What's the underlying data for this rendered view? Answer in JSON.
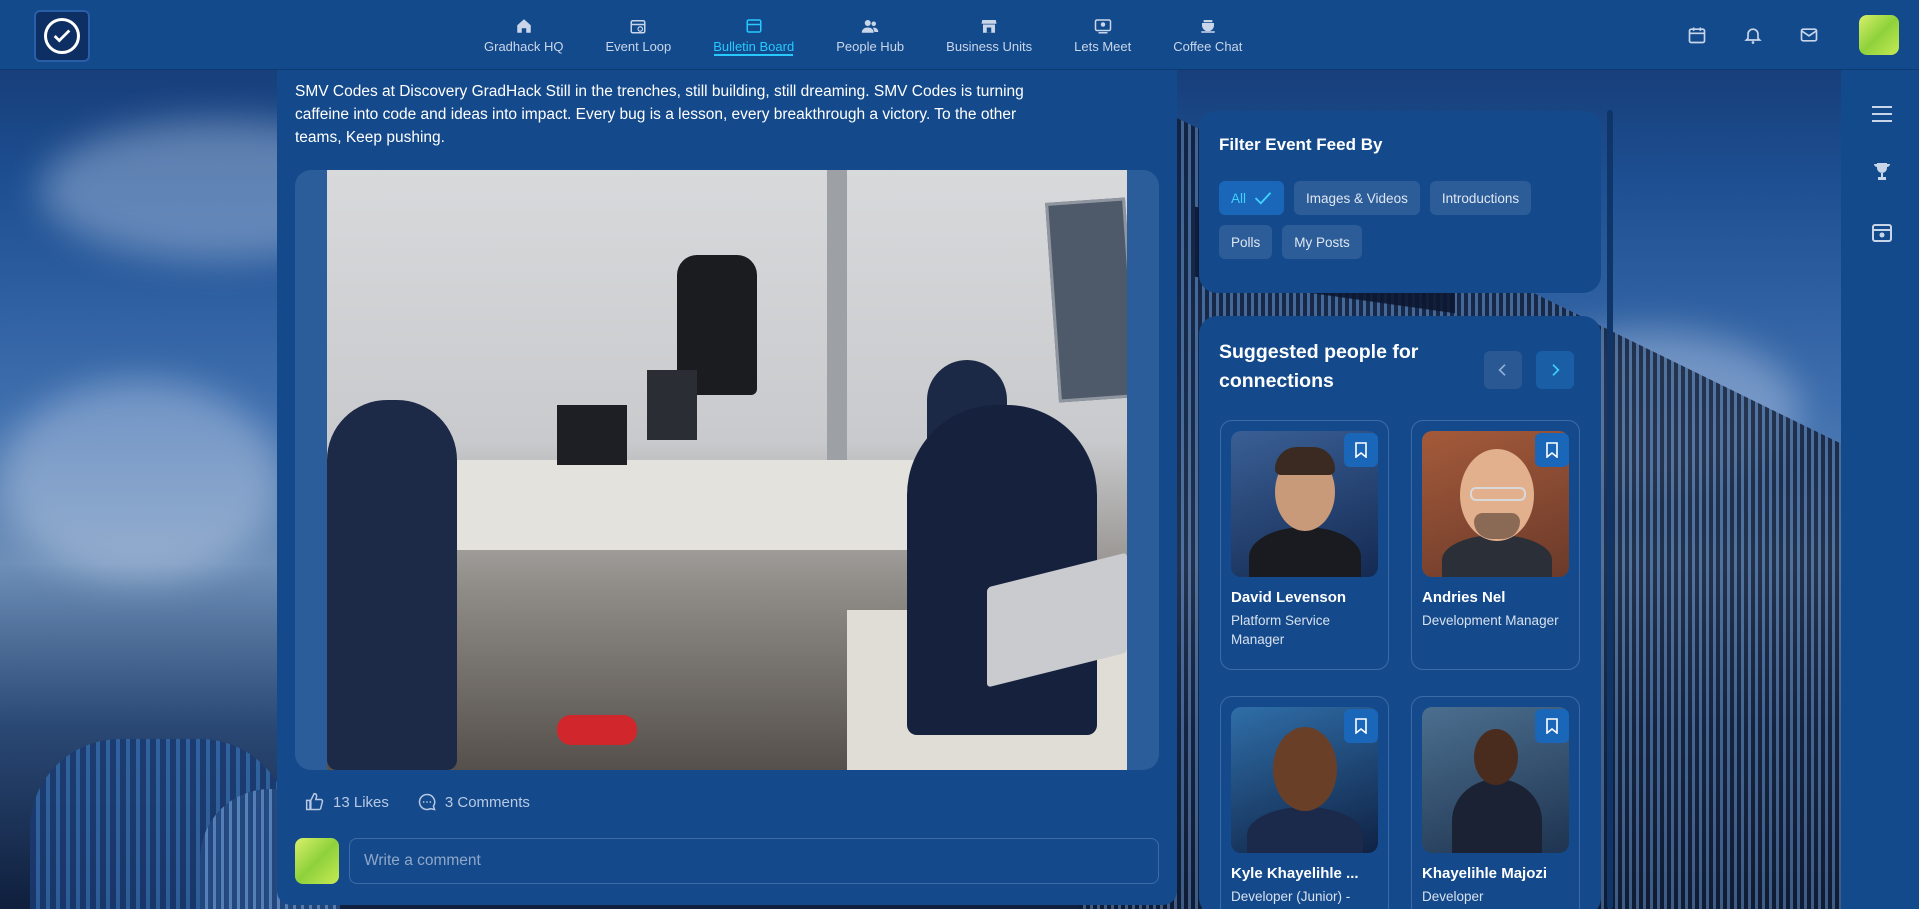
{
  "nav": {
    "items": [
      {
        "label": "Gradhack HQ",
        "icon": "home-icon"
      },
      {
        "label": "Event Loop",
        "icon": "calendar-clock-icon"
      },
      {
        "label": "Bulletin Board",
        "icon": "board-icon",
        "active": true
      },
      {
        "label": "People Hub",
        "icon": "people-icon"
      },
      {
        "label": "Business Units",
        "icon": "store-icon"
      },
      {
        "label": "Lets Meet",
        "icon": "video-meeting-icon"
      },
      {
        "label": "Coffee Chat",
        "icon": "coffee-icon"
      }
    ]
  },
  "post": {
    "text": "SMV Codes at Discovery GradHack  Still in the trenches, still building, still dreaming. SMV Codes is turning caffeine into code and ideas into impact. Every bug is a lesson, every breakthrough a victory. To the other teams, Keep pushing.",
    "likes_label": "13 Likes",
    "comments_label": "3 Comments",
    "comment_placeholder": "Write a comment"
  },
  "filter": {
    "title": "Filter Event Feed By",
    "chips": [
      "All",
      "Images & Videos",
      "Introductions",
      "Polls",
      "My Posts"
    ]
  },
  "suggested": {
    "title": "Suggested people for connections",
    "people": [
      {
        "name": "David Levenson",
        "role": "Platform Service Manager"
      },
      {
        "name": "Andries Nel",
        "role": "Development Manager"
      },
      {
        "name": "Kyle Khayelihle ...",
        "role": "Developer (Junior) -"
      },
      {
        "name": "Khayelihle Majozi",
        "role": "Developer"
      }
    ]
  },
  "colors": {
    "navbar": "#134a8c",
    "accent": "#27c9ff",
    "card": "#144a8b"
  }
}
